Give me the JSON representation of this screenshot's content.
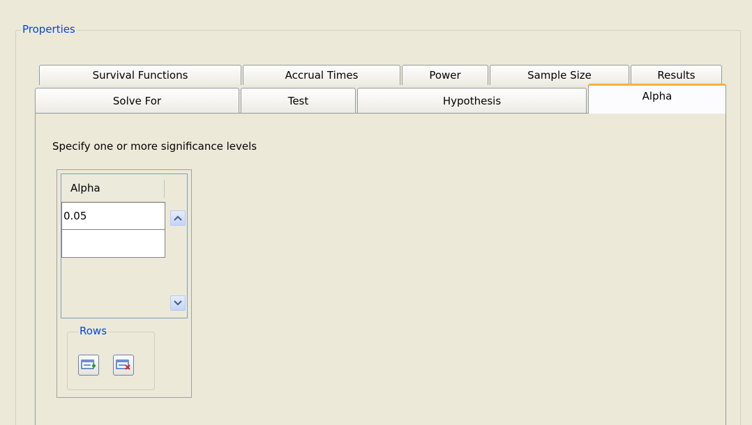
{
  "properties": {
    "title": "Properties"
  },
  "tabs": {
    "back_row": [
      "Survival Functions",
      "Accrual Times",
      "Power",
      "Sample Size",
      "Results"
    ],
    "front_row": [
      "Solve For",
      "Test",
      "Hypothesis",
      "Alpha"
    ],
    "active": "Alpha"
  },
  "alpha_panel": {
    "instruction": "Specify one or more significance levels",
    "column_header": "Alpha",
    "values": [
      "0.05",
      ""
    ],
    "rows_group_title": "Rows",
    "add_row_icon": "add-row-icon",
    "delete_row_icon": "delete-row-icon"
  },
  "colors": {
    "group_title": "#0046d5",
    "active_tab_accent": "#f8b03c",
    "background": "#ece9d8"
  }
}
